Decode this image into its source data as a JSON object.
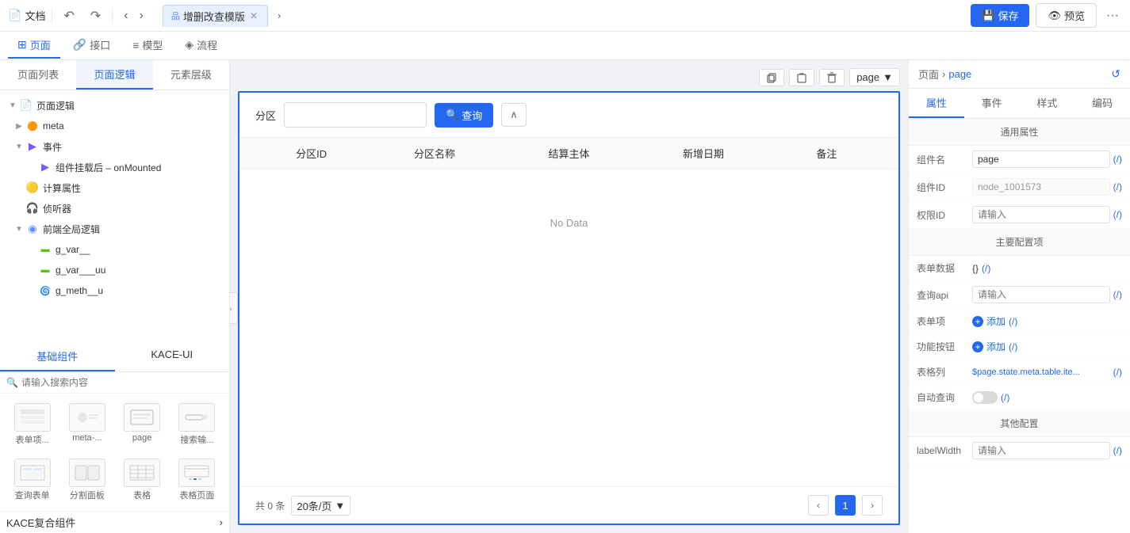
{
  "topbar": {
    "doc_label": "文档",
    "undo_label": "↺",
    "redo_label": "↻",
    "nav_left": "‹",
    "nav_right": "›",
    "tab_icon": "品",
    "tab_label": "增删改查模版",
    "save_label": "保存",
    "preview_label": "预览",
    "more_label": "···"
  },
  "nav_tabs": [
    {
      "id": "page",
      "label": "页面",
      "icon": "⊞"
    },
    {
      "id": "api",
      "label": "接口",
      "icon": "🔗"
    },
    {
      "id": "model",
      "label": "模型",
      "icon": "≡"
    },
    {
      "id": "flow",
      "label": "流程",
      "icon": "◈"
    }
  ],
  "left_panel": {
    "tabs": [
      {
        "id": "page-list",
        "label": "页面列表"
      },
      {
        "id": "page-logic",
        "label": "页面逻辑",
        "active": true
      },
      {
        "id": "element-layer",
        "label": "元素层级"
      }
    ],
    "tree": {
      "root_label": "页面逻辑",
      "items": [
        {
          "id": "meta",
          "label": "meta",
          "level": 1,
          "icon": "🟠",
          "expandable": true
        },
        {
          "id": "events",
          "label": "事件",
          "level": 1,
          "icon": "🔵",
          "expandable": true,
          "expanded": true
        },
        {
          "id": "onMounted",
          "label": "组件挂载后 – onMounted",
          "level": 2,
          "icon": "🔵"
        },
        {
          "id": "computed",
          "label": "计算属性",
          "level": 1,
          "icon": "🟡"
        },
        {
          "id": "listener",
          "label": "侦听器",
          "level": 1,
          "icon": "🔴"
        },
        {
          "id": "global-logic",
          "label": "前端全局逻辑",
          "level": 1,
          "icon": "🔵",
          "expandable": true,
          "expanded": true
        },
        {
          "id": "g_var",
          "label": "g_var__",
          "level": 2,
          "icon": "🟢"
        },
        {
          "id": "g_var_uu",
          "label": "g_var___uu",
          "level": 2,
          "icon": "🟢"
        },
        {
          "id": "g_meth_u",
          "label": "g_meth__u",
          "level": 2,
          "icon": "🔴"
        }
      ]
    },
    "comp_tabs": [
      {
        "id": "basic",
        "label": "基础组件",
        "active": true
      },
      {
        "id": "kace",
        "label": "KACE-UI"
      }
    ],
    "search_placeholder": "请输入搜索内容",
    "components": [
      {
        "id": "form-table",
        "label": "表单项..."
      },
      {
        "id": "meta-dash",
        "label": "meta-..."
      },
      {
        "id": "page",
        "label": "page"
      },
      {
        "id": "search-input",
        "label": "搜索输..."
      },
      {
        "id": "query-form",
        "label": "查询表单",
        "icon_type": "table"
      },
      {
        "id": "split-panel",
        "label": "分割面板",
        "icon_type": "split"
      },
      {
        "id": "table",
        "label": "表格",
        "icon_type": "grid"
      },
      {
        "id": "table-page",
        "label": "表格页面",
        "icon_type": "table-page"
      }
    ],
    "kace_label": "KACE复合组件",
    "kace_arrow": "›"
  },
  "canvas": {
    "toolbar_icons": [
      "copy",
      "paste",
      "delete"
    ],
    "page_badge": "page",
    "query_bar": {
      "label": "分区",
      "input_placeholder": "",
      "query_btn": "查询",
      "collapse_btn": "∧"
    },
    "table": {
      "columns": [
        "分区ID",
        "分区名称",
        "结算主体",
        "新增日期",
        "备注"
      ],
      "no_data": "No Data"
    },
    "pagination": {
      "total": "共 0 条",
      "per_page": "20条/页",
      "current_page": "1"
    }
  },
  "right_panel": {
    "breadcrumb": {
      "root": "页面",
      "separator": "›",
      "current": "page"
    },
    "refresh_icon": "↺",
    "tabs": [
      {
        "id": "props",
        "label": "属性",
        "active": true
      },
      {
        "id": "events",
        "label": "事件"
      },
      {
        "id": "style",
        "label": "样式"
      },
      {
        "id": "code",
        "label": "编码"
      }
    ],
    "sections": {
      "general": {
        "title": "通用属性",
        "fields": [
          {
            "label": "组件名",
            "value": "page",
            "type": "input",
            "slash": true
          },
          {
            "label": "组件ID",
            "value": "node_1001573",
            "type": "disabled",
            "slash": true
          },
          {
            "label": "权限ID",
            "value": "",
            "placeholder": "请输入",
            "type": "input",
            "slash": true
          }
        ]
      },
      "main": {
        "title": "主要配置项",
        "fields": [
          {
            "label": "表单数据",
            "value": "{}",
            "type": "braces",
            "slash": true
          },
          {
            "label": "查询api",
            "value": "",
            "placeholder": "请输入",
            "type": "input",
            "slash_blue": true
          },
          {
            "label": "表单项",
            "value": "添加",
            "type": "add-link",
            "slash": true
          },
          {
            "label": "功能按钮",
            "value": "添加",
            "type": "add-link",
            "slash": true
          },
          {
            "label": "表格列",
            "value": "$page.state.meta.table.ite...",
            "type": "long-value",
            "slash": true
          },
          {
            "label": "自动查询",
            "value": "",
            "type": "toggle",
            "slash": true
          }
        ]
      },
      "other": {
        "title": "其他配置",
        "fields": [
          {
            "label": "labelWidth",
            "value": "",
            "placeholder": "请输入",
            "type": "input",
            "slash": true
          }
        ]
      }
    }
  }
}
